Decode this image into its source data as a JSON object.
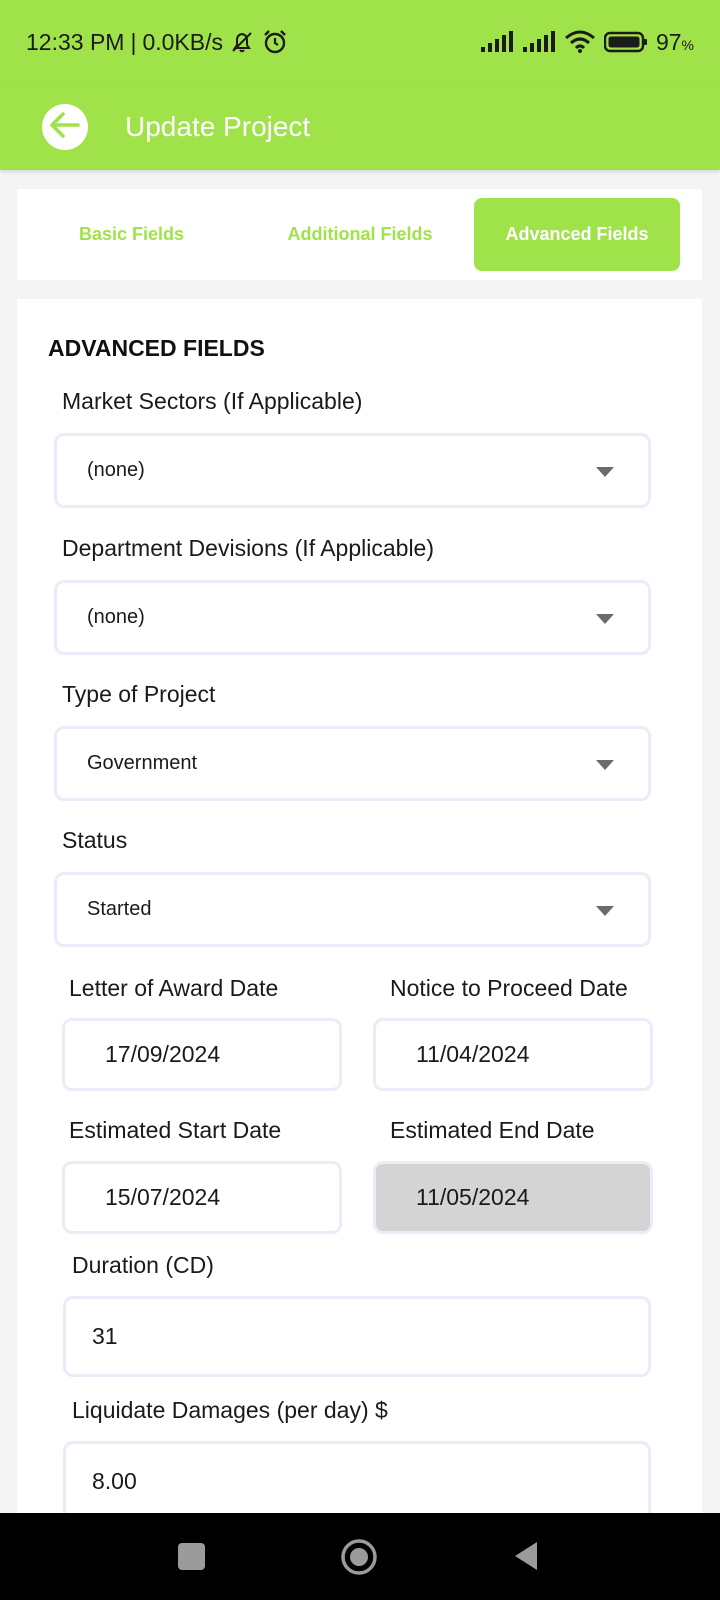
{
  "status_bar": {
    "time": "12:33 PM",
    "speed": "0.0KB/s",
    "battery_percent": "97",
    "battery_unit": "%",
    "icons": [
      "mute-bell-icon",
      "alarm-icon",
      "signal-icon",
      "signal-icon",
      "wifi-icon",
      "battery-icon"
    ]
  },
  "app_bar": {
    "title": "Update Project",
    "back_icon": "back-arrow-icon"
  },
  "tabs": [
    {
      "label": "Basic Fields",
      "active": false
    },
    {
      "label": "Additional Fields",
      "active": false
    },
    {
      "label": "Advanced Fields",
      "active": true
    }
  ],
  "section": {
    "title": "ADVANCED FIELDS"
  },
  "fields": {
    "market_sectors": {
      "label": "Market Sectors (If Applicable)",
      "value": "(none)"
    },
    "department_divisions": {
      "label": "Department Devisions (If Applicable)",
      "value": "(none)"
    },
    "type_of_project": {
      "label": "Type of Project",
      "value": "Government"
    },
    "status": {
      "label": "Status",
      "value": "Started"
    },
    "letter_of_award_date": {
      "label": "Letter of Award Date",
      "value": "17/09/2024"
    },
    "notice_to_proceed_date": {
      "label": "Notice to Proceed Date",
      "value": "11/04/2024"
    },
    "estimated_start_date": {
      "label": "Estimated Start Date",
      "value": "15/07/2024"
    },
    "estimated_end_date": {
      "label": "Estimated End Date",
      "value": "11/05/2024",
      "disabled": true
    },
    "duration": {
      "label": "Duration (CD)",
      "value": "31"
    },
    "liquidated_damages": {
      "label": "Liquidate Damages (per day) $",
      "value": "8.00"
    }
  },
  "nav_bar": {
    "icons": [
      "recent-apps-icon",
      "home-icon",
      "back-icon"
    ]
  },
  "colors": {
    "accent": "#a0e24a",
    "field_border": "#ecebfa",
    "disabled_field": "#d4d4d4"
  }
}
